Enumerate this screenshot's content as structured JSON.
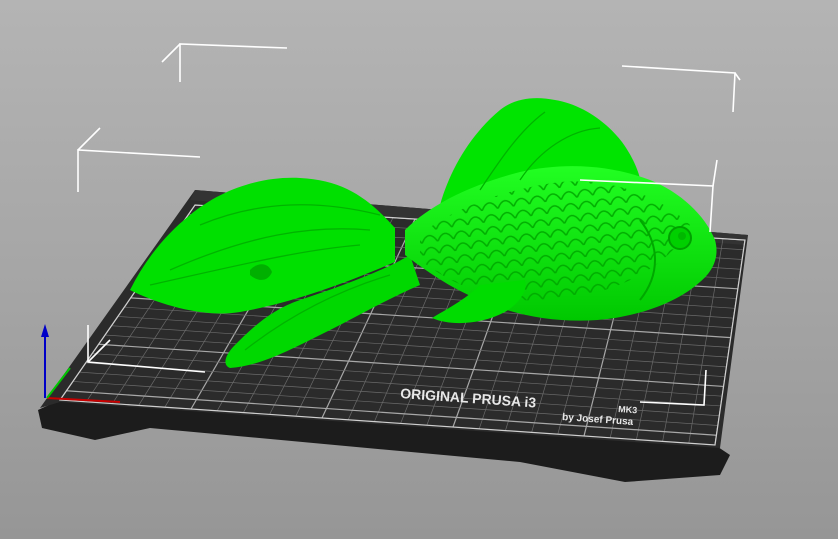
{
  "app": {
    "view": "3D preview",
    "model_color": "#00ee00",
    "bed_color": "#2b2b2b",
    "grid_color": "#8a8a8a"
  },
  "bed": {
    "label_main": "ORIGINAL PRUSA i3",
    "label_model": "MK3",
    "label_author": "by Josef Prusa"
  },
  "axes": {
    "z_color": "#0000c8",
    "x_color": "#c80000",
    "y_color": "#00c800"
  },
  "model": {
    "name": "fish-model",
    "selected": true
  },
  "icons": [
    "axis-z-arrow",
    "axis-x-line",
    "axis-y-line"
  ]
}
